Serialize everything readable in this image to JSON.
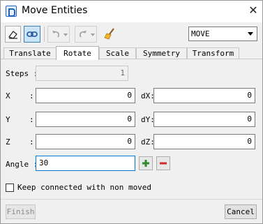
{
  "window": {
    "title": "Move Entities",
    "close_glyph": "✕"
  },
  "toolbar": {
    "icons": [
      "eraser-icon",
      "link-icon",
      "undo-icon",
      "redo-icon",
      "broom-icon"
    ],
    "mode_select": {
      "value": "MOVE"
    }
  },
  "tabs": [
    {
      "label": "Translate"
    },
    {
      "label": "Rotate",
      "active": true
    },
    {
      "label": "Scale"
    },
    {
      "label": "Symmetry"
    },
    {
      "label": "Transform"
    }
  ],
  "form": {
    "steps": {
      "label": "Steps :",
      "value": "1"
    },
    "x": {
      "label": "X",
      "colon": ":",
      "value": "0"
    },
    "y": {
      "label": "Y",
      "colon": ":",
      "value": "0"
    },
    "z": {
      "label": "Z",
      "colon": ":",
      "value": "0"
    },
    "dx": {
      "label": "dX:",
      "value": "0"
    },
    "dy": {
      "label": "dY:",
      "value": "0"
    },
    "dz": {
      "label": "dZ:",
      "value": "0"
    },
    "angle": {
      "label": "Angle :",
      "value": "30"
    }
  },
  "keep_connected": {
    "label": "Keep connected with non moved",
    "checked": false
  },
  "buttons": {
    "finish": "Finish",
    "cancel": "Cancel"
  },
  "colors": {
    "accent": "#0078d7",
    "plus": "#2e8b2e",
    "minus": "#d22a2a"
  }
}
